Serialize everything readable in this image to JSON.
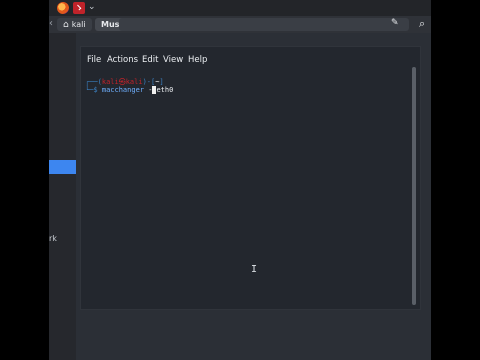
{
  "taskbar": {
    "apps": [
      "firefox-icon",
      "terminal-icon"
    ]
  },
  "pathbar": {
    "home_crumb": "kali",
    "current_crumb": "Music"
  },
  "sidebar": {
    "truncated_label": "rk"
  },
  "terminal": {
    "menu": [
      "File",
      "Actions",
      "Edit",
      "View",
      "Help"
    ],
    "prompt": {
      "open": "┌──(",
      "user": "kali㉿kali",
      "sep": ")-[",
      "dir": "~",
      "close": "]",
      "line2_prefix": "└─$ ",
      "command": "macchanger",
      "arg_before_cursor": " -",
      "arg_after_cursor": "eth0"
    }
  },
  "colors": {
    "accent_blue": "#3d86f0",
    "prompt_red": "#c0232a",
    "command_blue": "#6fb0ff"
  }
}
